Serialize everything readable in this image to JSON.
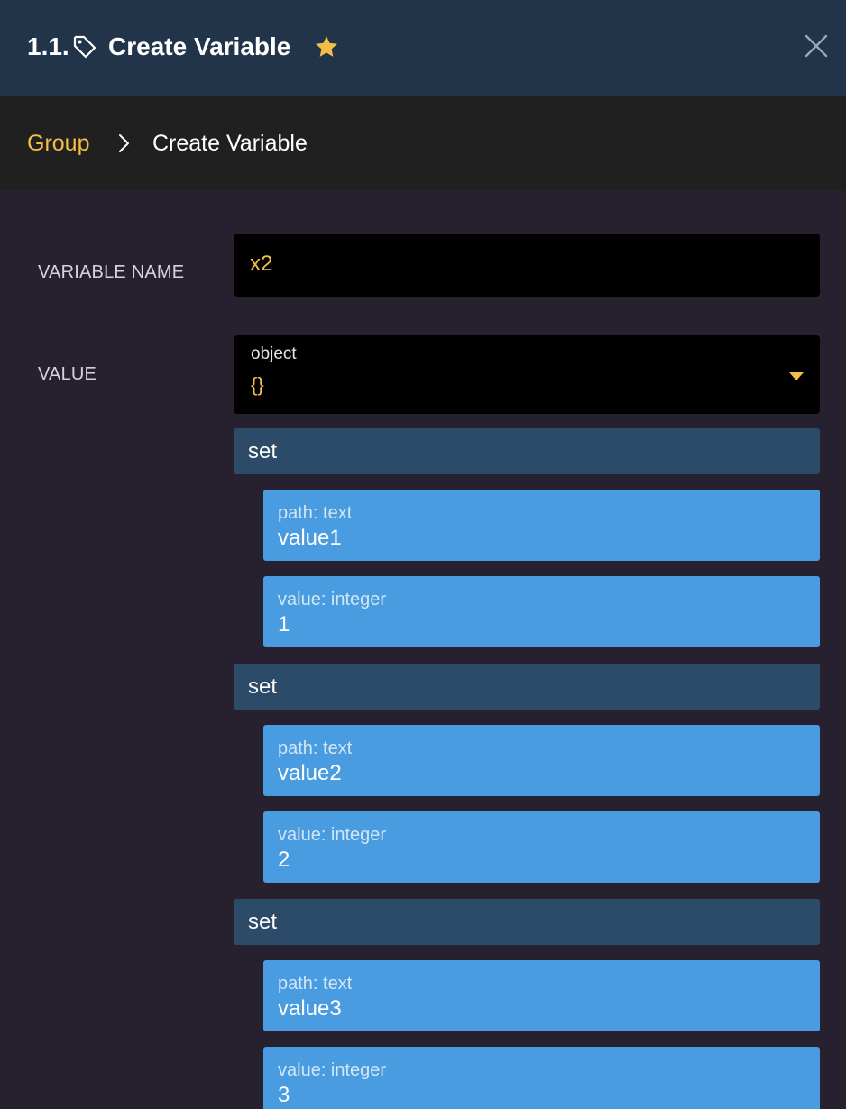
{
  "header": {
    "step_number": "1.1.",
    "title": "Create Variable",
    "tag_icon": "tag-icon",
    "favorite_icon": "star-icon",
    "close_icon": "close-icon",
    "star_color": "#f3bd46"
  },
  "breadcrumb": {
    "parent": "Group",
    "current": "Create Variable",
    "separator_icon": "chevron-right-icon"
  },
  "form": {
    "variable_name": {
      "label": "VARIABLE NAME",
      "value": "x2"
    },
    "value": {
      "label": "VALUE",
      "type": "object",
      "display": "{}",
      "dropdown_icon": "caret-down-icon"
    }
  },
  "operations": [
    {
      "label": "set",
      "path": {
        "label": "path: text",
        "value": "value1"
      },
      "value": {
        "label": "value: integer",
        "value": "1"
      }
    },
    {
      "label": "set",
      "path": {
        "label": "path: text",
        "value": "value2"
      },
      "value": {
        "label": "value: integer",
        "value": "2"
      }
    },
    {
      "label": "set",
      "path": {
        "label": "path: text",
        "value": "value3"
      },
      "value": {
        "label": "value: integer",
        "value": "3"
      }
    }
  ],
  "colors": {
    "header_bg": "#22344a",
    "breadcrumb_bg": "#202020",
    "body_bg": "#27212f",
    "accent": "#f3bd46",
    "set_bar": "#2c4b68",
    "param_box": "#4a9ce0"
  }
}
